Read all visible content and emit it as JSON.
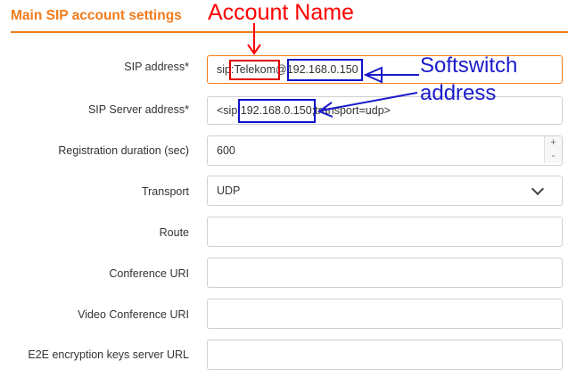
{
  "section": {
    "title": "Main SIP account settings"
  },
  "annotations": {
    "account_name": "Account Name",
    "softswitch_line1": "Softswitch",
    "softswitch_line2": "address"
  },
  "fields": {
    "sip_address": {
      "label": "SIP address*",
      "value": "sip:Telekom@192.168.0.150"
    },
    "sip_server": {
      "label": "SIP Server address*",
      "value": "<sip:192.168.0.150;transport=udp>"
    },
    "registration": {
      "label": "Registration duration (sec)",
      "value": "600",
      "plus": "+",
      "minus": "-"
    },
    "transport": {
      "label": "Transport",
      "value": "UDP"
    },
    "route": {
      "label": "Route",
      "value": ""
    },
    "conference": {
      "label": "Conference URI",
      "value": ""
    },
    "video_conference": {
      "label": "Video Conference URI",
      "value": ""
    },
    "e2e": {
      "label": "E2E encryption keys server URL",
      "value": ""
    }
  },
  "colors": {
    "accent": "#f07c1c",
    "annotation_red": "#ff0000",
    "annotation_blue": "#1a1acc"
  }
}
